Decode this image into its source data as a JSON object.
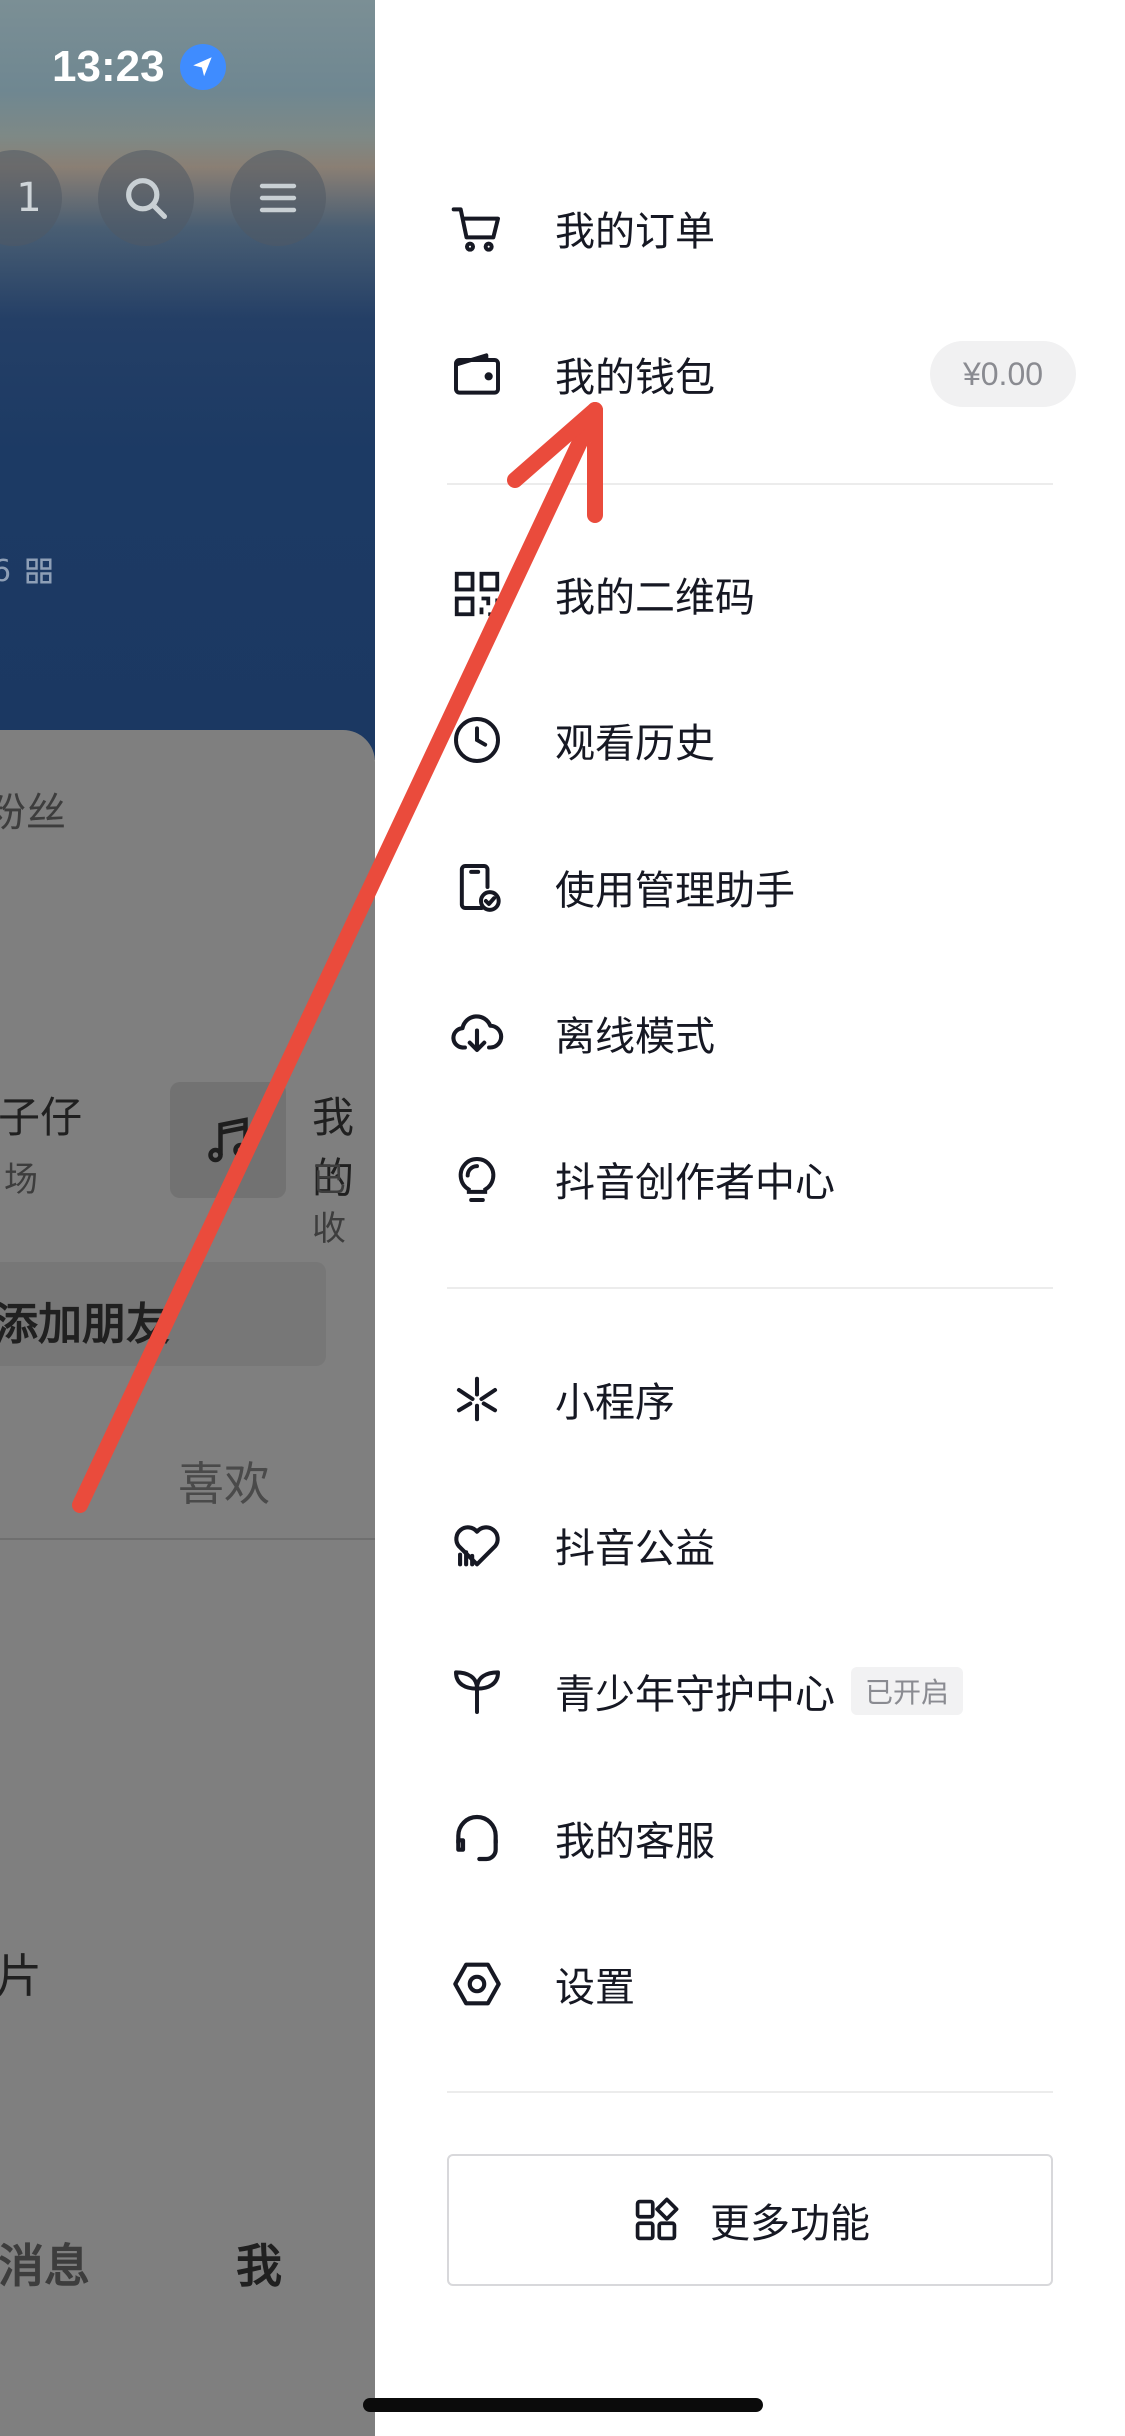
{
  "status_bar": {
    "time": "13:23"
  },
  "background": {
    "badge_count": "1",
    "fans_label": "粉丝",
    "user_name_fragment": "子仔",
    "user_sub_fragment": "场",
    "music_title_fragment": "我的",
    "music_sub_fragment": "已收",
    "add_friend": "添加朋友",
    "tab_likes": "喜欢",
    "photos_fragment": "片",
    "nav_messages": "消息",
    "nav_me": "我",
    "small_id_fragment": "6"
  },
  "drawer": {
    "items": [
      {
        "label": "我的订单",
        "icon": "cart-icon"
      },
      {
        "label": "我的钱包",
        "icon": "wallet-icon",
        "badge": "¥0.00"
      },
      {
        "label": "我的二维码",
        "icon": "qrcode-icon"
      },
      {
        "label": "观看历史",
        "icon": "clock-icon"
      },
      {
        "label": "使用管理助手",
        "icon": "phone-check-icon"
      },
      {
        "label": "离线模式",
        "icon": "cloud-download-icon"
      },
      {
        "label": "抖音创作者中心",
        "icon": "lightbulb-icon"
      },
      {
        "label": "小程序",
        "icon": "mini-program-icon"
      },
      {
        "label": "抖音公益",
        "icon": "heart-charity-icon"
      },
      {
        "label": "青少年守护中心",
        "icon": "sprout-icon",
        "badge": "已开启"
      },
      {
        "label": "我的客服",
        "icon": "headset-icon"
      },
      {
        "label": "设置",
        "icon": "hexagon-settings-icon"
      }
    ],
    "more_button": "更多功能"
  },
  "colors": {
    "arrow": "#ea4b3c",
    "text": "#161823",
    "badge_text": "#8a8b91",
    "location": "#3f8cff"
  }
}
